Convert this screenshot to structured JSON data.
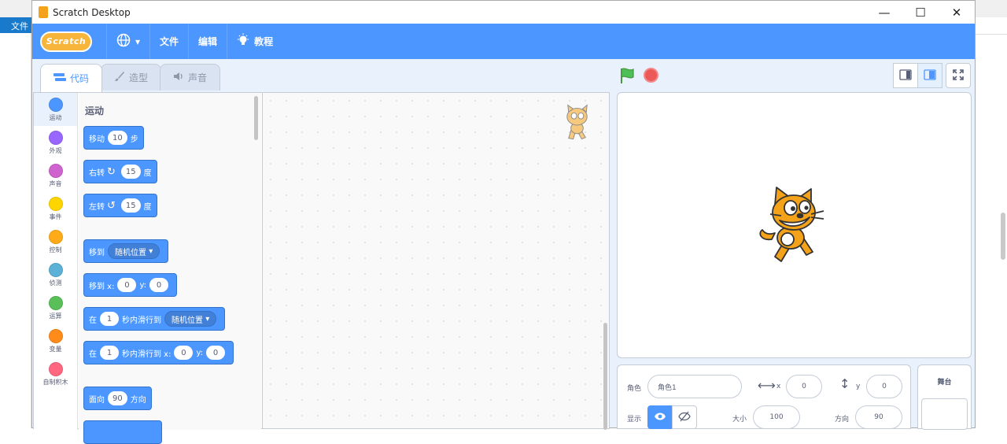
{
  "window": {
    "title": "Scratch Desktop",
    "minimize": "—",
    "maximize": "☐",
    "close": "✕"
  },
  "background": {
    "menu_label": "文件"
  },
  "menubar": {
    "logo": "Scratch",
    "language_icon": "globe-icon",
    "items": [
      {
        "label": "文件"
      },
      {
        "label": "编辑"
      },
      {
        "label": "教程"
      }
    ]
  },
  "tabs": [
    {
      "label": "代码",
      "icon": "code-icon",
      "active": true
    },
    {
      "label": "造型",
      "icon": "brush-icon",
      "active": false
    },
    {
      "label": "声音",
      "icon": "speaker-icon",
      "active": false
    }
  ],
  "categories": [
    {
      "label": "运动",
      "color": "#4c97ff"
    },
    {
      "label": "外观",
      "color": "#9966ff"
    },
    {
      "label": "声音",
      "color": "#cf63cf"
    },
    {
      "label": "事件",
      "color": "#ffd500"
    },
    {
      "label": "控制",
      "color": "#ffab19"
    },
    {
      "label": "侦测",
      "color": "#5cb1d6"
    },
    {
      "label": "运算",
      "color": "#59c059"
    },
    {
      "label": "变量",
      "color": "#ff8c1a"
    },
    {
      "label": "自制积木",
      "color": "#ff6680"
    }
  ],
  "palette": {
    "section_title": "运动",
    "blocks": {
      "move": {
        "text": "移动",
        "value": "10",
        "suffix": "步"
      },
      "turn_right": {
        "text": "右转",
        "value": "15",
        "suffix": "度"
      },
      "turn_left": {
        "text": "左转",
        "value": "15",
        "suffix": "度"
      },
      "goto": {
        "text": "移到",
        "dropdown": "随机位置"
      },
      "goto_xy": {
        "text": "移到 x:",
        "x": "0",
        "ylabel": "y:",
        "y": "0"
      },
      "glide": {
        "prefix": "在",
        "value": "1",
        "text": "秒内滑行到",
        "dropdown": "随机位置"
      },
      "glide_xy": {
        "prefix": "在",
        "value": "1",
        "text": "秒内滑行到 x:",
        "x": "0",
        "ylabel": "y:",
        "y": "0"
      },
      "point": {
        "text": "面向",
        "value": "90",
        "suffix": "方向"
      }
    }
  },
  "sprite_info": {
    "sprite_label": "角色",
    "sprite_name": "角色1",
    "x_label": "x",
    "x_value": "0",
    "y_label": "y",
    "y_value": "0",
    "show_label": "显示",
    "size_label": "大小",
    "size_value": "100",
    "direction_label": "方向",
    "direction_value": "90"
  },
  "stage_pane": {
    "title": "舞台"
  },
  "colors": {
    "menubar": "#4c97ff",
    "motion": "#4c97ff",
    "flag": "#4cbf56",
    "stop": "#ec5959"
  }
}
